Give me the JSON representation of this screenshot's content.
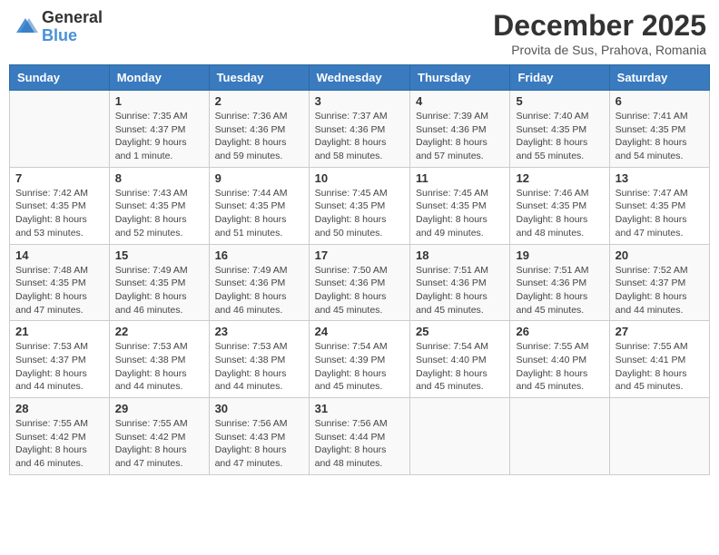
{
  "header": {
    "logo_general": "General",
    "logo_blue": "Blue",
    "month_year": "December 2025",
    "location": "Provita de Sus, Prahova, Romania"
  },
  "weekdays": [
    "Sunday",
    "Monday",
    "Tuesday",
    "Wednesday",
    "Thursday",
    "Friday",
    "Saturday"
  ],
  "weeks": [
    [
      {
        "day": "",
        "sunrise": "",
        "sunset": "",
        "daylight": ""
      },
      {
        "day": "1",
        "sunrise": "Sunrise: 7:35 AM",
        "sunset": "Sunset: 4:37 PM",
        "daylight": "Daylight: 9 hours and 1 minute."
      },
      {
        "day": "2",
        "sunrise": "Sunrise: 7:36 AM",
        "sunset": "Sunset: 4:36 PM",
        "daylight": "Daylight: 8 hours and 59 minutes."
      },
      {
        "day": "3",
        "sunrise": "Sunrise: 7:37 AM",
        "sunset": "Sunset: 4:36 PM",
        "daylight": "Daylight: 8 hours and 58 minutes."
      },
      {
        "day": "4",
        "sunrise": "Sunrise: 7:39 AM",
        "sunset": "Sunset: 4:36 PM",
        "daylight": "Daylight: 8 hours and 57 minutes."
      },
      {
        "day": "5",
        "sunrise": "Sunrise: 7:40 AM",
        "sunset": "Sunset: 4:35 PM",
        "daylight": "Daylight: 8 hours and 55 minutes."
      },
      {
        "day": "6",
        "sunrise": "Sunrise: 7:41 AM",
        "sunset": "Sunset: 4:35 PM",
        "daylight": "Daylight: 8 hours and 54 minutes."
      }
    ],
    [
      {
        "day": "7",
        "sunrise": "Sunrise: 7:42 AM",
        "sunset": "Sunset: 4:35 PM",
        "daylight": "Daylight: 8 hours and 53 minutes."
      },
      {
        "day": "8",
        "sunrise": "Sunrise: 7:43 AM",
        "sunset": "Sunset: 4:35 PM",
        "daylight": "Daylight: 8 hours and 52 minutes."
      },
      {
        "day": "9",
        "sunrise": "Sunrise: 7:44 AM",
        "sunset": "Sunset: 4:35 PM",
        "daylight": "Daylight: 8 hours and 51 minutes."
      },
      {
        "day": "10",
        "sunrise": "Sunrise: 7:45 AM",
        "sunset": "Sunset: 4:35 PM",
        "daylight": "Daylight: 8 hours and 50 minutes."
      },
      {
        "day": "11",
        "sunrise": "Sunrise: 7:45 AM",
        "sunset": "Sunset: 4:35 PM",
        "daylight": "Daylight: 8 hours and 49 minutes."
      },
      {
        "day": "12",
        "sunrise": "Sunrise: 7:46 AM",
        "sunset": "Sunset: 4:35 PM",
        "daylight": "Daylight: 8 hours and 48 minutes."
      },
      {
        "day": "13",
        "sunrise": "Sunrise: 7:47 AM",
        "sunset": "Sunset: 4:35 PM",
        "daylight": "Daylight: 8 hours and 47 minutes."
      }
    ],
    [
      {
        "day": "14",
        "sunrise": "Sunrise: 7:48 AM",
        "sunset": "Sunset: 4:35 PM",
        "daylight": "Daylight: 8 hours and 47 minutes."
      },
      {
        "day": "15",
        "sunrise": "Sunrise: 7:49 AM",
        "sunset": "Sunset: 4:35 PM",
        "daylight": "Daylight: 8 hours and 46 minutes."
      },
      {
        "day": "16",
        "sunrise": "Sunrise: 7:49 AM",
        "sunset": "Sunset: 4:36 PM",
        "daylight": "Daylight: 8 hours and 46 minutes."
      },
      {
        "day": "17",
        "sunrise": "Sunrise: 7:50 AM",
        "sunset": "Sunset: 4:36 PM",
        "daylight": "Daylight: 8 hours and 45 minutes."
      },
      {
        "day": "18",
        "sunrise": "Sunrise: 7:51 AM",
        "sunset": "Sunset: 4:36 PM",
        "daylight": "Daylight: 8 hours and 45 minutes."
      },
      {
        "day": "19",
        "sunrise": "Sunrise: 7:51 AM",
        "sunset": "Sunset: 4:36 PM",
        "daylight": "Daylight: 8 hours and 45 minutes."
      },
      {
        "day": "20",
        "sunrise": "Sunrise: 7:52 AM",
        "sunset": "Sunset: 4:37 PM",
        "daylight": "Daylight: 8 hours and 44 minutes."
      }
    ],
    [
      {
        "day": "21",
        "sunrise": "Sunrise: 7:53 AM",
        "sunset": "Sunset: 4:37 PM",
        "daylight": "Daylight: 8 hours and 44 minutes."
      },
      {
        "day": "22",
        "sunrise": "Sunrise: 7:53 AM",
        "sunset": "Sunset: 4:38 PM",
        "daylight": "Daylight: 8 hours and 44 minutes."
      },
      {
        "day": "23",
        "sunrise": "Sunrise: 7:53 AM",
        "sunset": "Sunset: 4:38 PM",
        "daylight": "Daylight: 8 hours and 44 minutes."
      },
      {
        "day": "24",
        "sunrise": "Sunrise: 7:54 AM",
        "sunset": "Sunset: 4:39 PM",
        "daylight": "Daylight: 8 hours and 45 minutes."
      },
      {
        "day": "25",
        "sunrise": "Sunrise: 7:54 AM",
        "sunset": "Sunset: 4:40 PM",
        "daylight": "Daylight: 8 hours and 45 minutes."
      },
      {
        "day": "26",
        "sunrise": "Sunrise: 7:55 AM",
        "sunset": "Sunset: 4:40 PM",
        "daylight": "Daylight: 8 hours and 45 minutes."
      },
      {
        "day": "27",
        "sunrise": "Sunrise: 7:55 AM",
        "sunset": "Sunset: 4:41 PM",
        "daylight": "Daylight: 8 hours and 45 minutes."
      }
    ],
    [
      {
        "day": "28",
        "sunrise": "Sunrise: 7:55 AM",
        "sunset": "Sunset: 4:42 PM",
        "daylight": "Daylight: 8 hours and 46 minutes."
      },
      {
        "day": "29",
        "sunrise": "Sunrise: 7:55 AM",
        "sunset": "Sunset: 4:42 PM",
        "daylight": "Daylight: 8 hours and 47 minutes."
      },
      {
        "day": "30",
        "sunrise": "Sunrise: 7:56 AM",
        "sunset": "Sunset: 4:43 PM",
        "daylight": "Daylight: 8 hours and 47 minutes."
      },
      {
        "day": "31",
        "sunrise": "Sunrise: 7:56 AM",
        "sunset": "Sunset: 4:44 PM",
        "daylight": "Daylight: 8 hours and 48 minutes."
      },
      {
        "day": "",
        "sunrise": "",
        "sunset": "",
        "daylight": ""
      },
      {
        "day": "",
        "sunrise": "",
        "sunset": "",
        "daylight": ""
      },
      {
        "day": "",
        "sunrise": "",
        "sunset": "",
        "daylight": ""
      }
    ]
  ]
}
